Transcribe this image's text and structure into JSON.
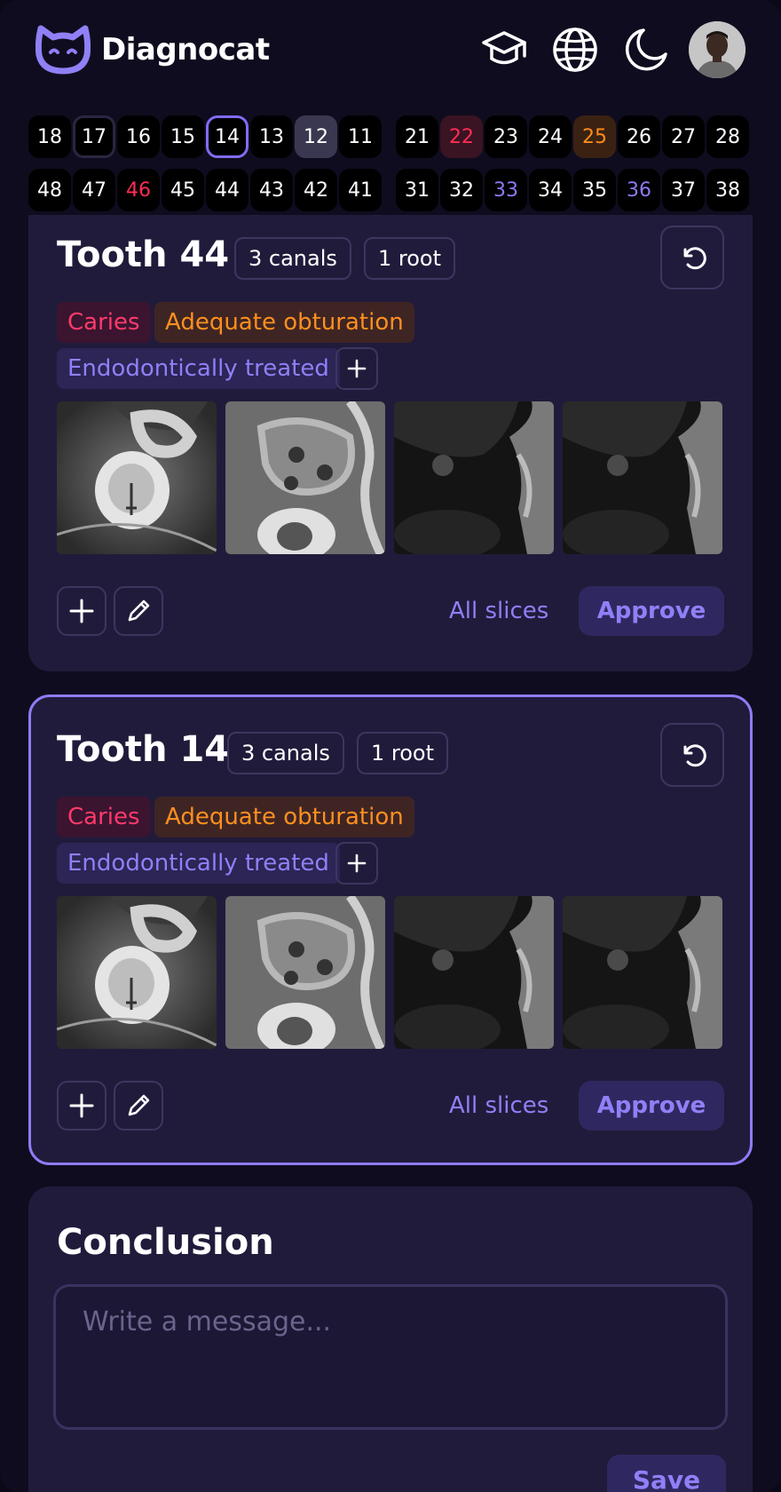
{
  "header": {
    "brand": "Diagnocat",
    "icons": [
      "graduation-cap-icon",
      "globe-icon",
      "moon-icon"
    ]
  },
  "tooth_map": {
    "upper": [
      {
        "n": "18",
        "state": "normal"
      },
      {
        "n": "17",
        "state": "outlined-dark"
      },
      {
        "n": "16",
        "state": "normal"
      },
      {
        "n": "15",
        "state": "normal"
      },
      {
        "n": "14",
        "state": "selected"
      },
      {
        "n": "13",
        "state": "normal"
      },
      {
        "n": "12",
        "state": "gray"
      },
      {
        "n": "11",
        "state": "normal"
      },
      {
        "n": "21",
        "state": "normal"
      },
      {
        "n": "22",
        "state": "red-bg"
      },
      {
        "n": "23",
        "state": "normal"
      },
      {
        "n": "24",
        "state": "normal"
      },
      {
        "n": "25",
        "state": "orange-bg"
      },
      {
        "n": "26",
        "state": "normal"
      },
      {
        "n": "27",
        "state": "normal"
      },
      {
        "n": "28",
        "state": "normal"
      }
    ],
    "lower": [
      {
        "n": "48",
        "state": "normal"
      },
      {
        "n": "47",
        "state": "normal"
      },
      {
        "n": "46",
        "state": "red-text"
      },
      {
        "n": "45",
        "state": "normal"
      },
      {
        "n": "44",
        "state": "normal"
      },
      {
        "n": "43",
        "state": "normal"
      },
      {
        "n": "42",
        "state": "normal"
      },
      {
        "n": "41",
        "state": "normal"
      },
      {
        "n": "31",
        "state": "normal"
      },
      {
        "n": "32",
        "state": "normal"
      },
      {
        "n": "33",
        "state": "purple-text"
      },
      {
        "n": "34",
        "state": "normal"
      },
      {
        "n": "35",
        "state": "normal"
      },
      {
        "n": "36",
        "state": "purple-text"
      },
      {
        "n": "37",
        "state": "normal"
      },
      {
        "n": "38",
        "state": "normal"
      }
    ]
  },
  "cards": [
    {
      "title": "Tooth 44",
      "canals": "3 canals",
      "roots": "1 root",
      "tags": {
        "caries": "Caries",
        "obturation": "Adequate obturation",
        "endo": "Endodontically treated"
      },
      "all_slices": "All slices",
      "approve": "Approve"
    },
    {
      "title": "Tooth 14",
      "canals": "3 canals",
      "roots": "1 root",
      "tags": {
        "caries": "Caries",
        "obturation": "Adequate obturation",
        "endo": "Endodontically treated"
      },
      "all_slices": "All slices",
      "approve": "Approve"
    }
  ],
  "conclusion": {
    "title": "Conclusion",
    "placeholder": "Write a message...",
    "save": "Save"
  },
  "colors": {
    "accent": "#8f80f7",
    "caries": "#ff3a6a",
    "obturation": "#ff8f1f",
    "card_bg": "#211b3b",
    "page_bg": "#100c1f"
  }
}
